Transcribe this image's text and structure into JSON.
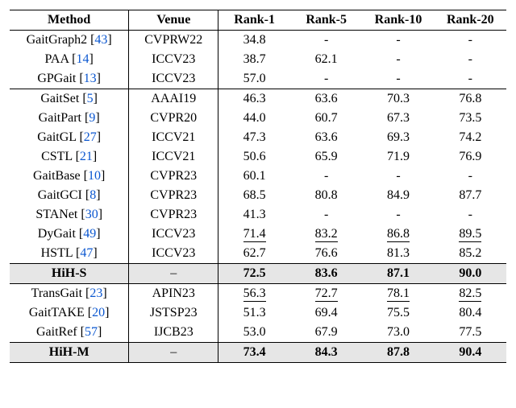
{
  "header": {
    "method": "Method",
    "venue": "Venue",
    "rank1": "Rank-1",
    "rank5": "Rank-5",
    "rank10": "Rank-10",
    "rank20": "Rank-20"
  },
  "groups": [
    {
      "rows": [
        {
          "method": "GaitGraph2",
          "cite": "43",
          "venue": "CVPRW22",
          "r1": "34.8",
          "r5": "-",
          "r10": "-",
          "r20": "-"
        },
        {
          "method": "PAA",
          "cite": "14",
          "venue": "ICCV23",
          "r1": "38.7",
          "r5": "62.1",
          "r10": "-",
          "r20": "-"
        },
        {
          "method": "GPGait",
          "cite": "13",
          "venue": "ICCV23",
          "r1": "57.0",
          "r5": "-",
          "r10": "-",
          "r20": "-"
        }
      ]
    },
    {
      "rows": [
        {
          "method": "GaitSet",
          "cite": "5",
          "venue": "AAAI19",
          "r1": "46.3",
          "r5": "63.6",
          "r10": "70.3",
          "r20": "76.8"
        },
        {
          "method": "GaitPart",
          "cite": "9",
          "venue": "CVPR20",
          "r1": "44.0",
          "r5": "60.7",
          "r10": "67.3",
          "r20": "73.5"
        },
        {
          "method": "GaitGL",
          "cite": "27",
          "venue": "ICCV21",
          "r1": "47.3",
          "r5": "63.6",
          "r10": "69.3",
          "r20": "74.2"
        },
        {
          "method": "CSTL",
          "cite": "21",
          "venue": "ICCV21",
          "r1": "50.6",
          "r5": "65.9",
          "r10": "71.9",
          "r20": "76.9"
        },
        {
          "method": "GaitBase",
          "cite": "10",
          "venue": "CVPR23",
          "r1": "60.1",
          "r5": "-",
          "r10": "-",
          "r20": "-"
        },
        {
          "method": "GaitGCI",
          "cite": "8",
          "venue": "CVPR23",
          "r1": "68.5",
          "r5": "80.8",
          "r10": "84.9",
          "r20": "87.7"
        },
        {
          "method": "STANet",
          "cite": "30",
          "venue": "CVPR23",
          "r1": "41.3",
          "r5": "-",
          "r10": "-",
          "r20": "-"
        },
        {
          "method": "DyGait",
          "cite": "49",
          "venue": "ICCV23",
          "r1": "71.4",
          "r5": "83.2",
          "r10": "86.8",
          "r20": "89.5",
          "underline": true
        },
        {
          "method": "HSTL",
          "cite": "47",
          "venue": "ICCV23",
          "r1": "62.7",
          "r5": "76.6",
          "r10": "81.3",
          "r20": "85.2"
        }
      ]
    },
    {
      "highlight": true,
      "rows": [
        {
          "method": "HiH-S",
          "venue": "–",
          "r1": "72.5",
          "r5": "83.6",
          "r10": "87.1",
          "r20": "90.0"
        }
      ]
    },
    {
      "rows": [
        {
          "method": "TransGait",
          "cite": "23",
          "venue": "APIN23",
          "r1": "56.3",
          "r5": "72.7",
          "r10": "78.1",
          "r20": "82.5",
          "underline": true
        },
        {
          "method": "GaitTAKE",
          "cite": "20",
          "venue": "JSTSP23",
          "r1": "51.3",
          "r5": "69.4",
          "r10": "75.5",
          "r20": "80.4"
        },
        {
          "method": "GaitRef",
          "cite": "57",
          "venue": "IJCB23",
          "r1": "53.0",
          "r5": "67.9",
          "r10": "73.0",
          "r20": "77.5"
        }
      ]
    },
    {
      "highlight": true,
      "rows": [
        {
          "method": "HiH-M",
          "venue": "–",
          "r1": "73.4",
          "r5": "84.3",
          "r10": "87.8",
          "r20": "90.4"
        }
      ]
    }
  ]
}
